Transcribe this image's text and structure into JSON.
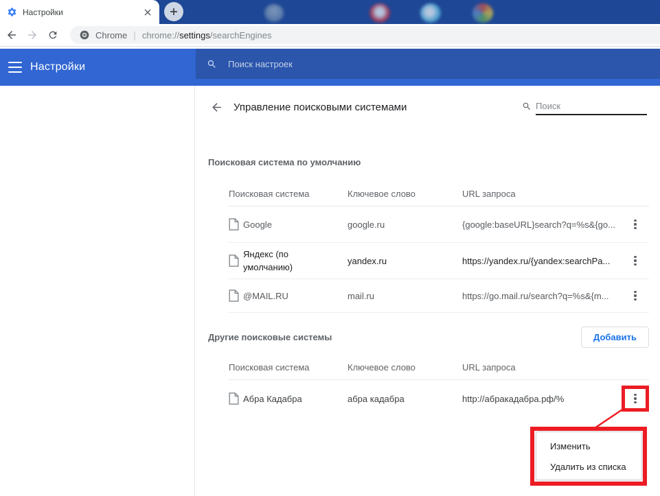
{
  "browser": {
    "tab": {
      "title": "Настройки"
    },
    "omnibox": {
      "site_label": "Chrome",
      "separator": "|",
      "url_prefix": "chrome://",
      "url_host": "settings",
      "url_suffix": "/searchEngines"
    }
  },
  "settings_header": {
    "title": "Настройки",
    "search_placeholder": "Поиск настроек"
  },
  "subpage": {
    "title": "Управление поисковыми системами",
    "search_placeholder": "Поиск"
  },
  "default_section": {
    "title": "Поисковая система по умолчанию",
    "columns": [
      "Поисковая система",
      "Ключевое слово",
      "URL запроса"
    ],
    "rows": [
      {
        "name": "Google",
        "keyword": "google.ru",
        "url": "{google:baseURL}search?q=%s&{go...",
        "is_default": false
      },
      {
        "name": "Яндекс (по умолчанию)",
        "keyword": "yandex.ru",
        "url": "https://yandex.ru/{yandex:searchPa...",
        "is_default": true
      },
      {
        "name": "@MAIL.RU",
        "keyword": "mail.ru",
        "url": "https://go.mail.ru/search?q=%s&{m...",
        "is_default": false
      }
    ]
  },
  "other_section": {
    "title": "Другие поисковые системы",
    "add_button": "Добавить",
    "columns": [
      "Поисковая система",
      "Ключевое слово",
      "URL запроса"
    ],
    "rows": [
      {
        "name": "Абра Кадабра",
        "keyword": "абра кадабра",
        "url": "http://абракадабра.рф/%"
      }
    ]
  },
  "context_menu": {
    "items": [
      "Изменить",
      "Удалить из списка"
    ]
  },
  "icons": {
    "tab_favicon": "gear",
    "omnibox_site_icon": "chrome-logo",
    "header_search_icon": "magnifier",
    "subpage_search_icon": "magnifier",
    "row_icon": "document-page",
    "row_menu_icon": "vertical-ellipsis"
  },
  "colors": {
    "tabstrip_blue": "#1e4795",
    "header_blue": "#3166d3",
    "header_search_blue": "#2b56ac",
    "link_blue": "#1a73e8",
    "annotation_red": "#ec1c24"
  }
}
